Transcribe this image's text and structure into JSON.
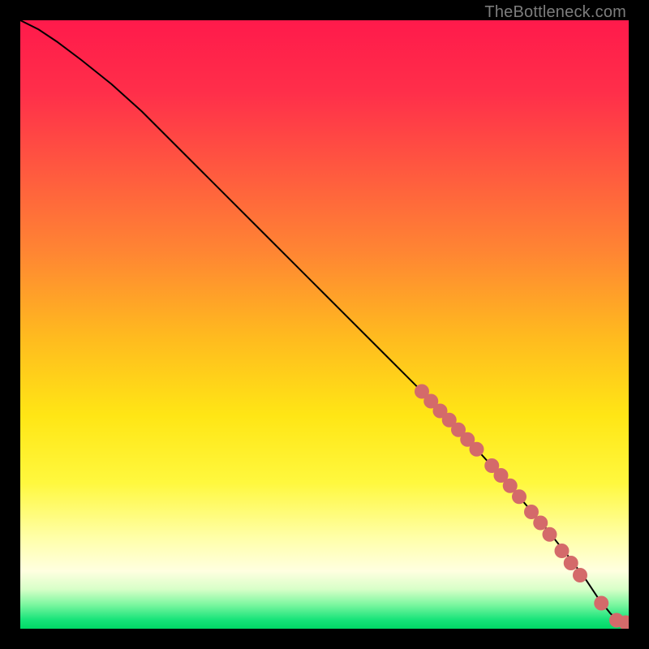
{
  "watermark": "TheBottleneck.com",
  "chart_data": {
    "type": "line",
    "title": "",
    "xlabel": "",
    "ylabel": "",
    "xlim": [
      0,
      100
    ],
    "ylim": [
      0,
      100
    ],
    "grid": false,
    "axes_visible": false,
    "background_gradient": {
      "stops": [
        {
          "offset": 0.0,
          "color": "#ff1a4b"
        },
        {
          "offset": 0.12,
          "color": "#ff2f4a"
        },
        {
          "offset": 0.25,
          "color": "#ff5a3f"
        },
        {
          "offset": 0.38,
          "color": "#ff8533"
        },
        {
          "offset": 0.52,
          "color": "#ffba1f"
        },
        {
          "offset": 0.65,
          "color": "#ffe615"
        },
        {
          "offset": 0.76,
          "color": "#fff83e"
        },
        {
          "offset": 0.85,
          "color": "#ffffa8"
        },
        {
          "offset": 0.905,
          "color": "#ffffe0"
        },
        {
          "offset": 0.935,
          "color": "#d8ffc8"
        },
        {
          "offset": 0.96,
          "color": "#7df7a0"
        },
        {
          "offset": 0.985,
          "color": "#18e47a"
        },
        {
          "offset": 1.0,
          "color": "#00d966"
        }
      ]
    },
    "series": [
      {
        "name": "curve",
        "stroke": "#000000",
        "x": [
          0,
          3,
          6,
          10,
          15,
          20,
          30,
          40,
          50,
          60,
          70,
          80,
          86,
          90,
          93,
          95,
          97,
          98.5,
          100
        ],
        "y": [
          100,
          98.5,
          96.5,
          93.5,
          89.5,
          85,
          75,
          65,
          55,
          45,
          35,
          24,
          17,
          12,
          8,
          5,
          2.5,
          1.2,
          1.0
        ]
      }
    ],
    "markers": {
      "color": "#d46a6a",
      "radius_frac": 0.012,
      "points": [
        {
          "x": 66.0,
          "y": 39.0
        },
        {
          "x": 67.5,
          "y": 37.4
        },
        {
          "x": 69.0,
          "y": 35.8
        },
        {
          "x": 70.5,
          "y": 34.3
        },
        {
          "x": 72.0,
          "y": 32.7
        },
        {
          "x": 73.5,
          "y": 31.1
        },
        {
          "x": 75.0,
          "y": 29.5
        },
        {
          "x": 77.5,
          "y": 26.8
        },
        {
          "x": 79.0,
          "y": 25.2
        },
        {
          "x": 80.5,
          "y": 23.5
        },
        {
          "x": 82.0,
          "y": 21.7
        },
        {
          "x": 84.0,
          "y": 19.2
        },
        {
          "x": 85.5,
          "y": 17.4
        },
        {
          "x": 87.0,
          "y": 15.5
        },
        {
          "x": 89.0,
          "y": 12.8
        },
        {
          "x": 90.5,
          "y": 10.8
        },
        {
          "x": 92.0,
          "y": 8.8
        },
        {
          "x": 95.5,
          "y": 4.2
        },
        {
          "x": 98.0,
          "y": 1.4
        },
        {
          "x": 99.5,
          "y": 1.0
        }
      ]
    }
  }
}
